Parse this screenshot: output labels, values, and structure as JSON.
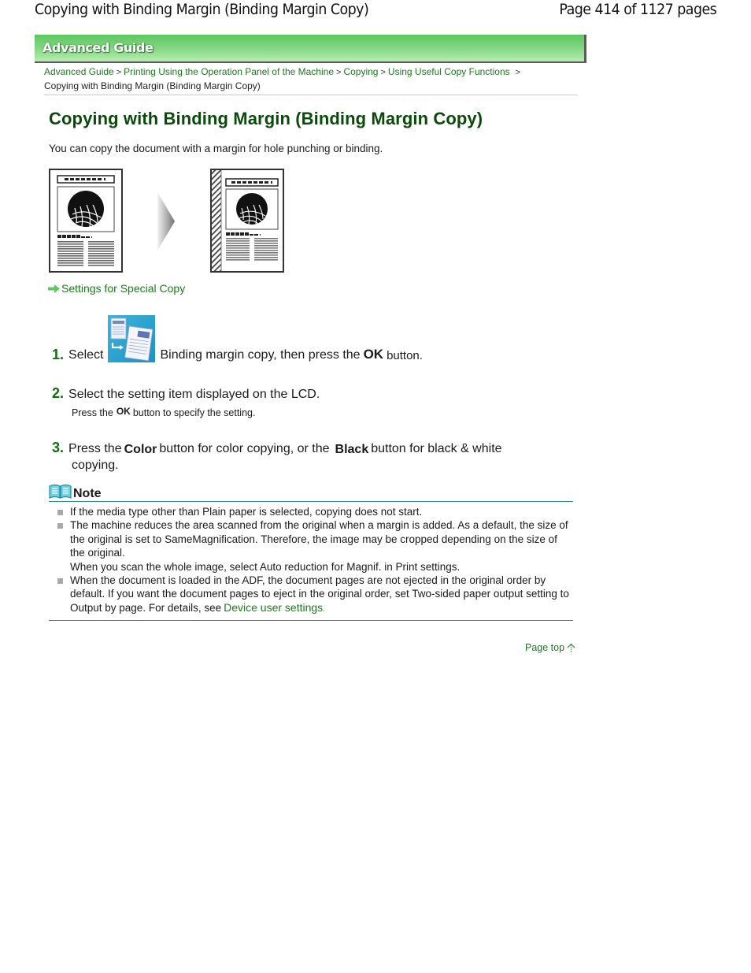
{
  "header": {
    "doc_title": "Copying with Binding Margin (Binding Margin Copy)",
    "page_count": "Page 414 of 1127 pages"
  },
  "banner": {
    "title": "Advanced Guide",
    "colors": {
      "top": "#5cc65f",
      "bottom": "#b7ecb0",
      "shadow": "#5a5a5a"
    }
  },
  "breadcrumb": {
    "items": [
      {
        "label": "Advanced Guide",
        "link": true
      },
      {
        "label": "Printing Using the Operation Panel of the Machine",
        "link": true
      },
      {
        "label": "Copying",
        "link": true
      },
      {
        "label": "Using Useful Copy Functions",
        "link": true
      }
    ],
    "separator": ">",
    "current": "Copying with Binding Margin (Binding Margin Copy)"
  },
  "main": {
    "title": "Copying with Binding Margin (Binding Margin Copy)",
    "intro": "You can copy the document with a margin for hole punching or binding.",
    "illustration": {
      "before_label": "original-document-icon",
      "after_label": "document-with-binding-margin-icon"
    },
    "related_link": "Settings for Special Copy",
    "steps": [
      {
        "number": "1.",
        "text_before": "Select",
        "icon": "binding-margin-copy-icon",
        "text_after": "Binding margin copy, then press the",
        "key": "OK",
        "text_end": "button."
      },
      {
        "number": "2.",
        "text": "Select the setting item displayed on the LCD.",
        "sub_before": "Press the",
        "sub_key": "OK",
        "sub_after": "button to specify the setting."
      },
      {
        "number": "3.",
        "text_a": "Press the",
        "key_a": "Color",
        "text_b": "button for color copying, or the",
        "key_b": "Black",
        "text_c": "button for black & white",
        "text_d": "copying."
      }
    ]
  },
  "note": {
    "title": "Note",
    "items": [
      {
        "text": "If the media type other than Plain paper is selected, copying does not start."
      },
      {
        "text": "The machine reduces the area scanned from the original when a margin is added. As a default, the size of the original is set to SameMagnification. Therefore, the image may be cropped depending on the size of the original.",
        "text2": "When you scan the whole image, select Auto reduction for Magnif. in Print settings."
      },
      {
        "text": "When the document is loaded in the ADF, the document pages are not ejected in the original order by default. If you want the document pages to eject in the original order, set Two-sided paper output setting to Output by page. For details, see",
        "link": "Device user settings",
        "tail": "."
      }
    ]
  },
  "footer": {
    "page_top": "Page top"
  },
  "colors": {
    "link": "#1d7a1d",
    "title": "#0b4a0b",
    "step_number": "#0f6e0f",
    "note_rule": "#2f8a93"
  }
}
